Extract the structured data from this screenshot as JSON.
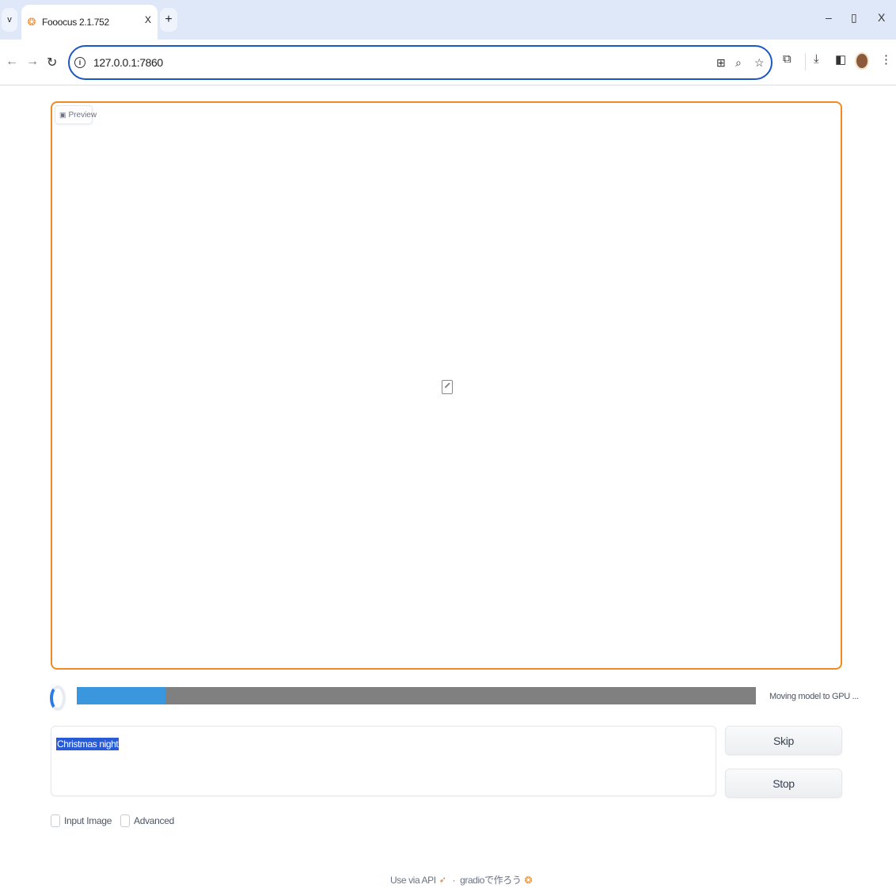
{
  "browser": {
    "tab": {
      "title": "Fooocus 2.1.752",
      "close": "X"
    },
    "tab_search_glyph": "v",
    "new_tab": "+",
    "window_controls": {
      "minimize": "–",
      "restore": "▯",
      "close": "X"
    },
    "address": "127.0.0.1:7860",
    "colors": {
      "accent": "#1a57c2",
      "tabstrip": "#dfe8f8"
    }
  },
  "preview": {
    "label": "Preview",
    "border_color": "#f08a24"
  },
  "progress": {
    "percent": 13,
    "status": "Moving model to GPU ..."
  },
  "prompt": {
    "value": "Christmas night"
  },
  "buttons": {
    "skip": "Skip",
    "stop": "Stop"
  },
  "options": {
    "input_image": "Input Image",
    "advanced": "Advanced"
  },
  "footer": {
    "api": "Use via API",
    "built_with": "gradioで作ろう",
    "separator": "·"
  }
}
